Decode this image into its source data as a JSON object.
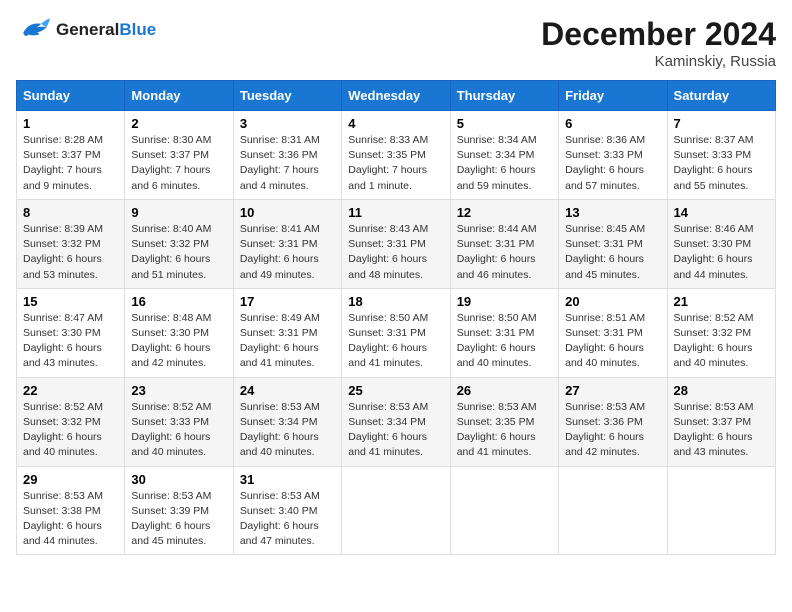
{
  "logo": {
    "line1": "General",
    "line2": "Blue"
  },
  "title": "December 2024",
  "location": "Kaminskiy, Russia",
  "weekdays": [
    "Sunday",
    "Monday",
    "Tuesday",
    "Wednesday",
    "Thursday",
    "Friday",
    "Saturday"
  ],
  "weeks": [
    [
      {
        "day": "1",
        "sunrise": "8:28 AM",
        "sunset": "3:37 PM",
        "daylight": "7 hours and 9 minutes."
      },
      {
        "day": "2",
        "sunrise": "8:30 AM",
        "sunset": "3:37 PM",
        "daylight": "7 hours and 6 minutes."
      },
      {
        "day": "3",
        "sunrise": "8:31 AM",
        "sunset": "3:36 PM",
        "daylight": "7 hours and 4 minutes."
      },
      {
        "day": "4",
        "sunrise": "8:33 AM",
        "sunset": "3:35 PM",
        "daylight": "7 hours and 1 minute."
      },
      {
        "day": "5",
        "sunrise": "8:34 AM",
        "sunset": "3:34 PM",
        "daylight": "6 hours and 59 minutes."
      },
      {
        "day": "6",
        "sunrise": "8:36 AM",
        "sunset": "3:33 PM",
        "daylight": "6 hours and 57 minutes."
      },
      {
        "day": "7",
        "sunrise": "8:37 AM",
        "sunset": "3:33 PM",
        "daylight": "6 hours and 55 minutes."
      }
    ],
    [
      {
        "day": "8",
        "sunrise": "8:39 AM",
        "sunset": "3:32 PM",
        "daylight": "6 hours and 53 minutes."
      },
      {
        "day": "9",
        "sunrise": "8:40 AM",
        "sunset": "3:32 PM",
        "daylight": "6 hours and 51 minutes."
      },
      {
        "day": "10",
        "sunrise": "8:41 AM",
        "sunset": "3:31 PM",
        "daylight": "6 hours and 49 minutes."
      },
      {
        "day": "11",
        "sunrise": "8:43 AM",
        "sunset": "3:31 PM",
        "daylight": "6 hours and 48 minutes."
      },
      {
        "day": "12",
        "sunrise": "8:44 AM",
        "sunset": "3:31 PM",
        "daylight": "6 hours and 46 minutes."
      },
      {
        "day": "13",
        "sunrise": "8:45 AM",
        "sunset": "3:31 PM",
        "daylight": "6 hours and 45 minutes."
      },
      {
        "day": "14",
        "sunrise": "8:46 AM",
        "sunset": "3:30 PM",
        "daylight": "6 hours and 44 minutes."
      }
    ],
    [
      {
        "day": "15",
        "sunrise": "8:47 AM",
        "sunset": "3:30 PM",
        "daylight": "6 hours and 43 minutes."
      },
      {
        "day": "16",
        "sunrise": "8:48 AM",
        "sunset": "3:30 PM",
        "daylight": "6 hours and 42 minutes."
      },
      {
        "day": "17",
        "sunrise": "8:49 AM",
        "sunset": "3:31 PM",
        "daylight": "6 hours and 41 minutes."
      },
      {
        "day": "18",
        "sunrise": "8:50 AM",
        "sunset": "3:31 PM",
        "daylight": "6 hours and 41 minutes."
      },
      {
        "day": "19",
        "sunrise": "8:50 AM",
        "sunset": "3:31 PM",
        "daylight": "6 hours and 40 minutes."
      },
      {
        "day": "20",
        "sunrise": "8:51 AM",
        "sunset": "3:31 PM",
        "daylight": "6 hours and 40 minutes."
      },
      {
        "day": "21",
        "sunrise": "8:52 AM",
        "sunset": "3:32 PM",
        "daylight": "6 hours and 40 minutes."
      }
    ],
    [
      {
        "day": "22",
        "sunrise": "8:52 AM",
        "sunset": "3:32 PM",
        "daylight": "6 hours and 40 minutes."
      },
      {
        "day": "23",
        "sunrise": "8:52 AM",
        "sunset": "3:33 PM",
        "daylight": "6 hours and 40 minutes."
      },
      {
        "day": "24",
        "sunrise": "8:53 AM",
        "sunset": "3:34 PM",
        "daylight": "6 hours and 40 minutes."
      },
      {
        "day": "25",
        "sunrise": "8:53 AM",
        "sunset": "3:34 PM",
        "daylight": "6 hours and 41 minutes."
      },
      {
        "day": "26",
        "sunrise": "8:53 AM",
        "sunset": "3:35 PM",
        "daylight": "6 hours and 41 minutes."
      },
      {
        "day": "27",
        "sunrise": "8:53 AM",
        "sunset": "3:36 PM",
        "daylight": "6 hours and 42 minutes."
      },
      {
        "day": "28",
        "sunrise": "8:53 AM",
        "sunset": "3:37 PM",
        "daylight": "6 hours and 43 minutes."
      }
    ],
    [
      {
        "day": "29",
        "sunrise": "8:53 AM",
        "sunset": "3:38 PM",
        "daylight": "6 hours and 44 minutes."
      },
      {
        "day": "30",
        "sunrise": "8:53 AM",
        "sunset": "3:39 PM",
        "daylight": "6 hours and 45 minutes."
      },
      {
        "day": "31",
        "sunrise": "8:53 AM",
        "sunset": "3:40 PM",
        "daylight": "6 hours and 47 minutes."
      },
      null,
      null,
      null,
      null
    ]
  ]
}
